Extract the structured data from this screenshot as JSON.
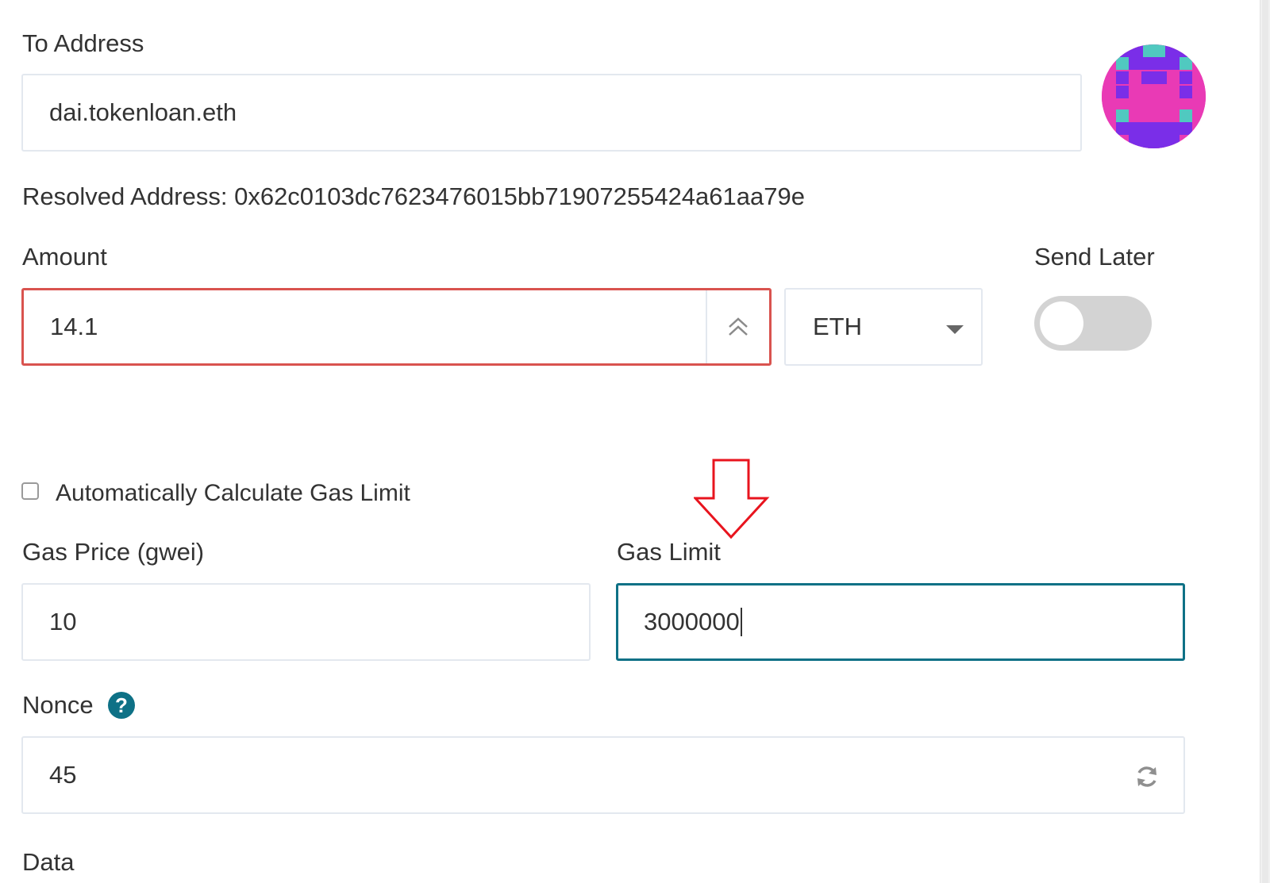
{
  "to_address": {
    "label": "To Address",
    "value": "dai.tokenloan.eth"
  },
  "resolved_address": {
    "text": "Resolved Address: 0x62c0103dc7623476015bb71907255424a61aa79e"
  },
  "amount": {
    "label": "Amount",
    "value": "14.1",
    "state": "error"
  },
  "currency": {
    "selected": "ETH"
  },
  "send_later": {
    "label": "Send Later",
    "enabled": false
  },
  "auto_gas": {
    "label": "Automatically Calculate Gas Limit",
    "checked": false
  },
  "gas_price": {
    "label": "Gas Price (gwei)",
    "value": "10"
  },
  "gas_limit": {
    "label": "Gas Limit",
    "value": "3000000",
    "focused": true
  },
  "nonce": {
    "label": "Nonce",
    "help_glyph": "?",
    "value": "45"
  },
  "data": {
    "label": "Data"
  },
  "colors": {
    "text": "#333333",
    "field_border": "#e3e8ef",
    "error_border": "#d9534f",
    "focus_border": "#0e7186",
    "help_icon": "#0e7186",
    "annotation_arrow": "#e8141e",
    "toggle_off": "#d3d3d3",
    "identicon_magenta": "#e93ab5",
    "identicon_purple": "#7a2ee8",
    "identicon_teal": "#50c9c0"
  },
  "icons": {
    "spinner": "double-chevron-up-icon",
    "dropdown": "caret-down-icon",
    "help": "question-circle-icon",
    "refresh": "refresh-icon",
    "annotation": "red-outline-down-arrow"
  }
}
